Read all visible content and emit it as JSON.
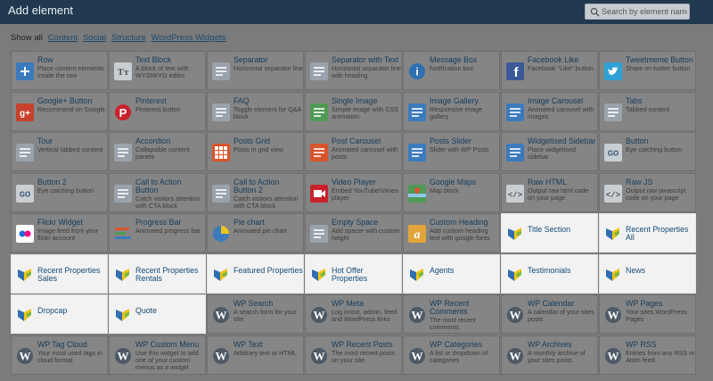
{
  "header": {
    "title": "Add element",
    "search_placeholder": "Search by element name"
  },
  "filters": [
    {
      "label": "Show all",
      "link": false
    },
    {
      "label": "Content",
      "link": true
    },
    {
      "label": "Social",
      "link": true
    },
    {
      "label": "Structure",
      "link": true
    },
    {
      "label": "WordPress Widgets",
      "link": true
    }
  ],
  "elements": [
    {
      "title": "Row",
      "desc": "Place content elements inside the row",
      "icon": "plus-icon",
      "color": "#3b7bbd",
      "hl": false
    },
    {
      "title": "Text Block",
      "desc": "A block of text with WYSIWYG editor",
      "icon": "text-icon",
      "color": "#9aa3ab",
      "hl": false
    },
    {
      "title": "Separator",
      "desc": "Horizontal separator line",
      "icon": "separator-icon",
      "color": "#9aa3ab",
      "hl": false
    },
    {
      "title": "Separator with Text",
      "desc": "Horizontal separator line with heading",
      "icon": "separator-text-icon",
      "color": "#9aa3ab",
      "hl": false
    },
    {
      "title": "Message Box",
      "desc": "Notification box",
      "icon": "info-icon",
      "color": "#2f6fb0",
      "hl": false
    },
    {
      "title": "Facebook Like",
      "desc": "Facebook \"Like\" button",
      "icon": "facebook-icon",
      "color": "#3b5998",
      "hl": false
    },
    {
      "title": "Tweetmeme Button",
      "desc": "Share on twitter button",
      "icon": "twitter-icon",
      "color": "#2fa1d6",
      "hl": false
    },
    {
      "title": "Google+ Button",
      "desc": "Recommend on Google",
      "icon": "googleplus-icon",
      "color": "#c6412b",
      "hl": false
    },
    {
      "title": "Pinterest",
      "desc": "Pinterest button",
      "icon": "pinterest-icon",
      "color": "#c8232c",
      "hl": false
    },
    {
      "title": "FAQ",
      "desc": "Toggle element for Q&A block",
      "icon": "faq-icon",
      "color": "#9aa3ab",
      "hl": false
    },
    {
      "title": "Single Image",
      "desc": "Simple image with CSS animation",
      "icon": "image-icon",
      "color": "#4f9a55",
      "hl": false
    },
    {
      "title": "Image Gallery",
      "desc": "Responsive image gallery",
      "icon": "gallery-icon",
      "color": "#3b7bbd",
      "hl": false
    },
    {
      "title": "Image Carousel",
      "desc": "Animated carousel with images",
      "icon": "carousel-icon",
      "color": "#3b7bbd",
      "hl": false
    },
    {
      "title": "Tabs",
      "desc": "Tabbed content",
      "icon": "tabs-icon",
      "color": "#9aa3ab",
      "hl": false
    },
    {
      "title": "Tour",
      "desc": "Vertical tabbed content",
      "icon": "tour-icon",
      "color": "#9aa3ab",
      "hl": false
    },
    {
      "title": "Accordion",
      "desc": "Collapsible content panels",
      "icon": "accordion-icon",
      "color": "#9aa3ab",
      "hl": false
    },
    {
      "title": "Posts Grid",
      "desc": "Posts in grid view",
      "icon": "posts-grid-icon",
      "color": "#d9542b",
      "hl": false
    },
    {
      "title": "Post Carousel",
      "desc": "Animated carousel with posts",
      "icon": "post-carousel-icon",
      "color": "#d9542b",
      "hl": false
    },
    {
      "title": "Posts Slider",
      "desc": "Slider with WP Posts",
      "icon": "posts-slider-icon",
      "color": "#3b7bbd",
      "hl": false
    },
    {
      "title": "Widgetised Sidebar",
      "desc": "Place widgetised sidebar",
      "icon": "sidebar-icon",
      "color": "#3b7bbd",
      "hl": false
    },
    {
      "title": "Button",
      "desc": "Eye catching button",
      "icon": "go-button-icon",
      "color": "#9aa3ab",
      "hl": false
    },
    {
      "title": "Button 2",
      "desc": "Eye catching button",
      "icon": "go-button-icon",
      "color": "#9aa3ab",
      "hl": false
    },
    {
      "title": "Call to Action Button",
      "desc": "Catch visitors attention with CTA block",
      "icon": "cta-icon",
      "color": "#9aa3ab",
      "hl": false
    },
    {
      "title": "Call to Action Button 2",
      "desc": "Catch visitors attention with CTA block",
      "icon": "cta-icon",
      "color": "#9aa3ab",
      "hl": false
    },
    {
      "title": "Video Player",
      "desc": "Embed YouTube/Vimeo player",
      "icon": "video-icon",
      "color": "#c8232c",
      "hl": false
    },
    {
      "title": "Google Maps",
      "desc": "Map block",
      "icon": "map-icon",
      "color": "#4f9a55",
      "hl": false
    },
    {
      "title": "Raw HTML",
      "desc": "Output raw html code on your page",
      "icon": "code-icon",
      "color": "#9aa3ab",
      "hl": false
    },
    {
      "title": "Raw JS",
      "desc": "Output raw javascript code on your page",
      "icon": "js-icon",
      "color": "#9aa3ab",
      "hl": false
    },
    {
      "title": "Flickr Widget",
      "desc": "Image feed from your flickr account",
      "icon": "flickr-icon",
      "color": "#ffffff",
      "hl": false
    },
    {
      "title": "Progress Bar",
      "desc": "Animated progress bar",
      "icon": "progress-icon",
      "color": "#d9542b",
      "hl": false
    },
    {
      "title": "Pie chart",
      "desc": "Animated pie chart",
      "icon": "pie-icon",
      "color": "#3b7bbd",
      "hl": false
    },
    {
      "title": "Empty Space",
      "desc": "Add spacer with custom height",
      "icon": "empty-space-icon",
      "color": "#9aa3ab",
      "hl": false
    },
    {
      "title": "Custom Heading",
      "desc": "Add custom heading text with google fonts",
      "icon": "heading-icon",
      "color": "#e3a53b",
      "hl": false
    },
    {
      "title": "Title Section",
      "desc": "",
      "icon": "theme-logo-icon",
      "color": "#f0c419",
      "hl": true
    },
    {
      "title": "Recent Properties All",
      "desc": "",
      "icon": "theme-logo-icon",
      "color": "#f0c419",
      "hl": true
    },
    {
      "title": "Recent Properties Sales",
      "desc": "",
      "icon": "theme-logo-icon",
      "color": "#f0c419",
      "hl": true
    },
    {
      "title": "Recent Properties Rentals",
      "desc": "",
      "icon": "theme-logo-icon",
      "color": "#f0c419",
      "hl": true
    },
    {
      "title": "Featured Properties",
      "desc": "",
      "icon": "theme-logo-icon",
      "color": "#f0c419",
      "hl": true
    },
    {
      "title": "Hot Offer Properties",
      "desc": "",
      "icon": "theme-logo-icon",
      "color": "#f0c419",
      "hl": true
    },
    {
      "title": "Agents",
      "desc": "",
      "icon": "theme-logo-icon",
      "color": "#f0c419",
      "hl": true
    },
    {
      "title": "Testimonials",
      "desc": "",
      "icon": "theme-logo-icon",
      "color": "#f0c419",
      "hl": true
    },
    {
      "title": "News",
      "desc": "",
      "icon": "theme-logo-icon",
      "color": "#f0c419",
      "hl": true
    },
    {
      "title": "Dropcap",
      "desc": "",
      "icon": "theme-logo-icon",
      "color": "#f0c419",
      "hl": true
    },
    {
      "title": "Quote",
      "desc": "",
      "icon": "theme-logo-icon",
      "color": "#f0c419",
      "hl": true
    },
    {
      "title": "WP Search",
      "desc": "A search form for your site",
      "icon": "wordpress-icon",
      "color": "#4d5a66",
      "hl": false
    },
    {
      "title": "WP Meta",
      "desc": "Log in/out, admin, feed and WordPress links",
      "icon": "wordpress-icon",
      "color": "#4d5a66",
      "hl": false
    },
    {
      "title": "WP Recent Comments",
      "desc": "The most recent comments",
      "icon": "wordpress-icon",
      "color": "#4d5a66",
      "hl": false
    },
    {
      "title": "WP Calendar",
      "desc": "A calendar of your sites posts",
      "icon": "wordpress-icon",
      "color": "#4d5a66",
      "hl": false
    },
    {
      "title": "WP Pages",
      "desc": "Your sites WordPress Pages",
      "icon": "wordpress-icon",
      "color": "#4d5a66",
      "hl": false
    },
    {
      "title": "WP Tag Cloud",
      "desc": "Your most used tags in cloud format",
      "icon": "wordpress-icon",
      "color": "#4d5a66",
      "hl": false
    },
    {
      "title": "WP Custom Menu",
      "desc": "Use this widget to add one of your custom menus as a widget",
      "icon": "wordpress-icon",
      "color": "#4d5a66",
      "hl": false
    },
    {
      "title": "WP Text",
      "desc": "Arbitrary text or HTML",
      "icon": "wordpress-icon",
      "color": "#4d5a66",
      "hl": false
    },
    {
      "title": "WP Recent Posts",
      "desc": "The most recent posts on your site",
      "icon": "wordpress-icon",
      "color": "#4d5a66",
      "hl": false
    },
    {
      "title": "WP Categories",
      "desc": "A list or dropdown of categories",
      "icon": "wordpress-icon",
      "color": "#4d5a66",
      "hl": false
    },
    {
      "title": "WP Archives",
      "desc": "A monthly archive of your sites posts",
      "icon": "wordpress-icon",
      "color": "#4d5a66",
      "hl": false
    },
    {
      "title": "WP RSS",
      "desc": "Entries from any RSS or Atom feed",
      "icon": "wordpress-icon",
      "color": "#4d5a66",
      "hl": false
    }
  ]
}
